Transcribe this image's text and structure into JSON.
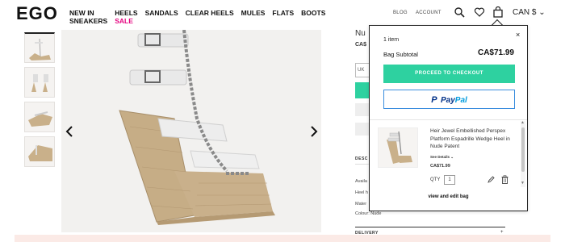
{
  "header": {
    "logo": "EGO",
    "nav": [
      {
        "line1": "NEW IN",
        "line2": "SNEAKERS"
      },
      {
        "line1": "HEELS",
        "line2": "SALE"
      },
      {
        "line1": "SANDALS",
        "line2": ""
      },
      {
        "line1": "CLEAR HEELS",
        "line2": ""
      },
      {
        "line1": "MULES",
        "line2": ""
      },
      {
        "line1": "FLATS",
        "line2": ""
      },
      {
        "line1": "BOOTS",
        "line2": ""
      }
    ],
    "blog": "BLOG",
    "account": "ACCOUNT",
    "currency": "CAN $ ⌄",
    "icons": [
      "search-icon",
      "heart-icon",
      "bag-icon"
    ]
  },
  "product": {
    "title_partial": "Nu",
    "price_partial": "CA$",
    "size_partial": "UK",
    "description_partial": "DESC",
    "details_partial": [
      "Availa",
      "Heel h",
      "Mater"
    ],
    "colour": "Colour: Nude",
    "delivery_partial": "DELIVERY"
  },
  "bag": {
    "items_count": "1 item",
    "subtotal_label": "Bag Subtotal",
    "subtotal_value": "CA$71.99",
    "checkout_label": "PROCEED TO CHECKOUT",
    "paypal_pay": "Pay",
    "paypal_pal": "Pal",
    "item": {
      "name": "Heir Jewel Embellished Perspex Platform Espadrille Wedge Heel in Nude Patent",
      "see_details": "See Details  ⌄",
      "price": "CA$71.99",
      "qty_label": "QTY",
      "qty_value": "1"
    },
    "view_edit": "view and edit bag",
    "close": "×"
  },
  "colors": {
    "accent_green": "#2ed1a0",
    "sale_pink": "#e5007e",
    "paypal_dark": "#003087",
    "paypal_light": "#009cde"
  }
}
